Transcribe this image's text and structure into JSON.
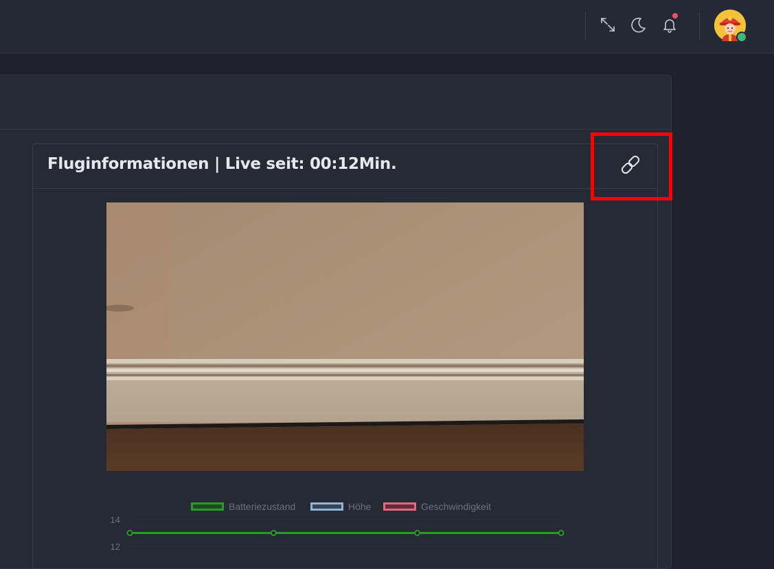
{
  "header": {
    "icons": {
      "fullscreen": "fullscreen-icon",
      "theme": "moon-icon",
      "notifications": "bell-icon"
    },
    "notification_dot_color": "#f0506e",
    "avatar_status_color": "#3fb57a"
  },
  "card": {
    "title": "Fluginformationen | Live seit: 00:12Min.",
    "link_icon": "link-icon"
  },
  "chart_data": {
    "type": "line",
    "x": [
      0,
      1,
      2,
      3
    ],
    "series": [
      {
        "name": "Batteriezustand",
        "values": [
          13,
          13,
          13,
          13
        ],
        "color": "#2b9a2b"
      },
      {
        "name": "Höhe",
        "values": [],
        "color": "#8fb4d4"
      },
      {
        "name": "Geschwindigkeit",
        "values": [],
        "color": "#f0657e"
      }
    ],
    "y_ticks": [
      "14",
      "12"
    ],
    "ylim": [
      12,
      14
    ]
  }
}
